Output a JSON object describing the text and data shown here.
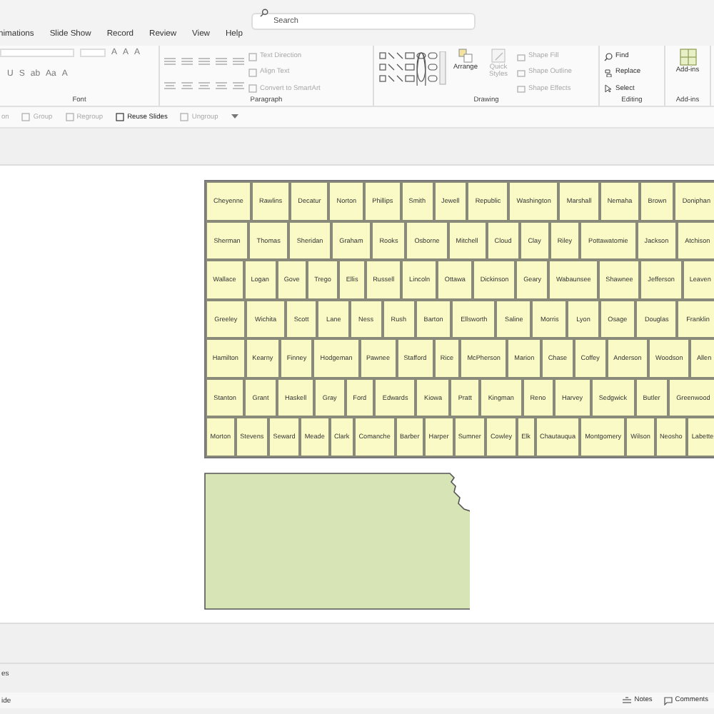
{
  "search": {
    "placeholder": "Search"
  },
  "tabs": [
    {
      "label": "nimations",
      "selected": false
    },
    {
      "label": "Slide Show",
      "selected": false
    },
    {
      "label": "Record",
      "selected": false
    },
    {
      "label": "Review",
      "selected": false
    },
    {
      "label": "View",
      "selected": false
    },
    {
      "label": "Help",
      "selected": false
    }
  ],
  "ribbon": {
    "font": {
      "label": "Font",
      "row_1": [
        "A",
        "A",
        "A"
      ],
      "row_2": [
        "U",
        "S",
        "ab",
        "Aa",
        "A"
      ]
    },
    "paragraph": {
      "label": "Paragraph",
      "commands": [
        {
          "label": "Text Direction",
          "disabled": true
        },
        {
          "label": "Align Text",
          "disabled": true
        },
        {
          "label": "Convert to SmartArt",
          "disabled": true
        }
      ]
    },
    "drawing": {
      "label": "Drawing",
      "arrange": {
        "label": "Arrange",
        "disabled": false
      },
      "quick_styles": {
        "label": "Quick Styles",
        "disabled": true
      },
      "commands": [
        {
          "label": "Shape Fill",
          "disabled": true
        },
        {
          "label": "Shape Outline",
          "disabled": true
        },
        {
          "label": "Shape Effects",
          "disabled": true
        }
      ]
    },
    "editing": {
      "label": "Editing",
      "commands": [
        {
          "label": "Find",
          "disabled": false
        },
        {
          "label": "Replace",
          "disabled": false
        },
        {
          "label": "Select",
          "disabled": false
        }
      ]
    },
    "addins": {
      "label": "Add-ins",
      "button": "Add-ins"
    }
  },
  "quick_access": [
    {
      "label": "on",
      "disabled": true
    },
    {
      "label": "Group",
      "disabled": true
    },
    {
      "label": "Regroup",
      "disabled": true
    },
    {
      "label": "Reuse Slides",
      "disabled": false
    },
    {
      "label": "Ungroup",
      "disabled": true
    }
  ],
  "map": {
    "rows": [
      [
        "Cheyenne",
        "Rawlins",
        "Decatur",
        "Norton",
        "Phillips",
        "Smith",
        "Jewell",
        "Republic",
        "Washington",
        "Marshall",
        "Nemaha",
        "Brown",
        "Doniphan"
      ],
      [
        "Sherman",
        "Thomas",
        "Sheridan",
        "Graham",
        "Rooks",
        "Osborne",
        "Mitchell",
        "Cloud",
        "Clay",
        "Riley",
        "Pottawatomie",
        "Jackson",
        "Atchison"
      ],
      [
        "Wallace",
        "Logan",
        "Gove",
        "Trego",
        "Ellis",
        "Russell",
        "Lincoln",
        "Ottawa",
        "Dickinson",
        "Geary",
        "Wabaunsee",
        "Shawnee",
        "Jefferson",
        "Leaven"
      ],
      [
        "Greeley",
        "Wichita",
        "Scott",
        "Lane",
        "Ness",
        "Rush",
        "Barton",
        "Ellsworth",
        "Saline",
        "Morris",
        "Lyon",
        "Osage",
        "Douglas",
        "Franklin"
      ],
      [
        "Hamilton",
        "Kearny",
        "Finney",
        "Hodgeman",
        "Pawnee",
        "Stafford",
        "Rice",
        "McPherson",
        "Marion",
        "Chase",
        "Coffey",
        "Anderson",
        "Woodson",
        "Allen"
      ],
      [
        "Stanton",
        "Grant",
        "Haskell",
        "Gray",
        "Ford",
        "Edwards",
        "Kiowa",
        "Pratt",
        "Kingman",
        "Reno",
        "Harvey",
        "Sedgwick",
        "Butler",
        "Greenwood"
      ],
      [
        "Morton",
        "Stevens",
        "Seward",
        "Meade",
        "Clark",
        "Comanche",
        "Barber",
        "Harper",
        "Sumner",
        "Cowley",
        "Elk",
        "Chautauqua",
        "Montgomery",
        "Wilson",
        "Neosho",
        "Labette"
      ]
    ]
  },
  "notes_pane": {
    "text": "es"
  },
  "status_bar": {
    "left": "ide",
    "buttons": [
      "Notes",
      "Comments"
    ]
  }
}
